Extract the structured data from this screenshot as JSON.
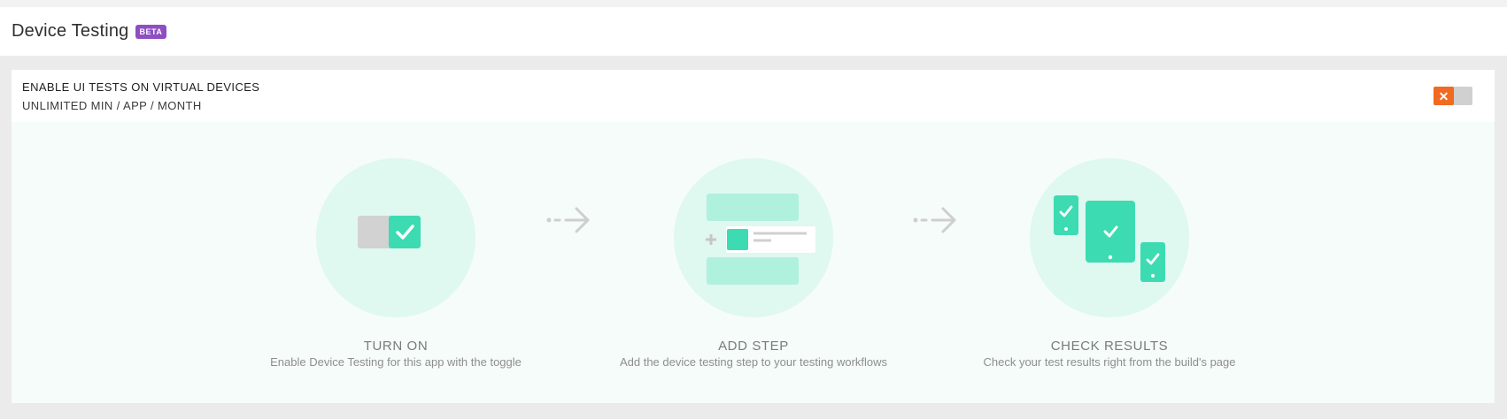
{
  "header": {
    "title": "Device Testing",
    "badge": "BETA"
  },
  "panel": {
    "title": "ENABLE UI TESTS ON VIRTUAL DEVICES",
    "subtitle": "UNLIMITED MIN / APP / MONTH",
    "toggle": {
      "state": "off",
      "icon": "close-icon",
      "color_off": "#f16a21"
    }
  },
  "steps": [
    {
      "title": "TURN ON",
      "description": "Enable Device Testing for this app with the toggle",
      "icon": "toggle-on-icon"
    },
    {
      "title": "ADD STEP",
      "description": "Add the device testing step to your testing workflows",
      "icon": "add-step-icon"
    },
    {
      "title": "CHECK RESULTS",
      "description": "Check your test results right from the build's page",
      "icon": "devices-check-icon"
    }
  ],
  "colors": {
    "accent": "#3ddbb2",
    "accent_light": "#b0f1de",
    "circle_bg": "#dff8f0",
    "badge": "#8e4fc2"
  }
}
